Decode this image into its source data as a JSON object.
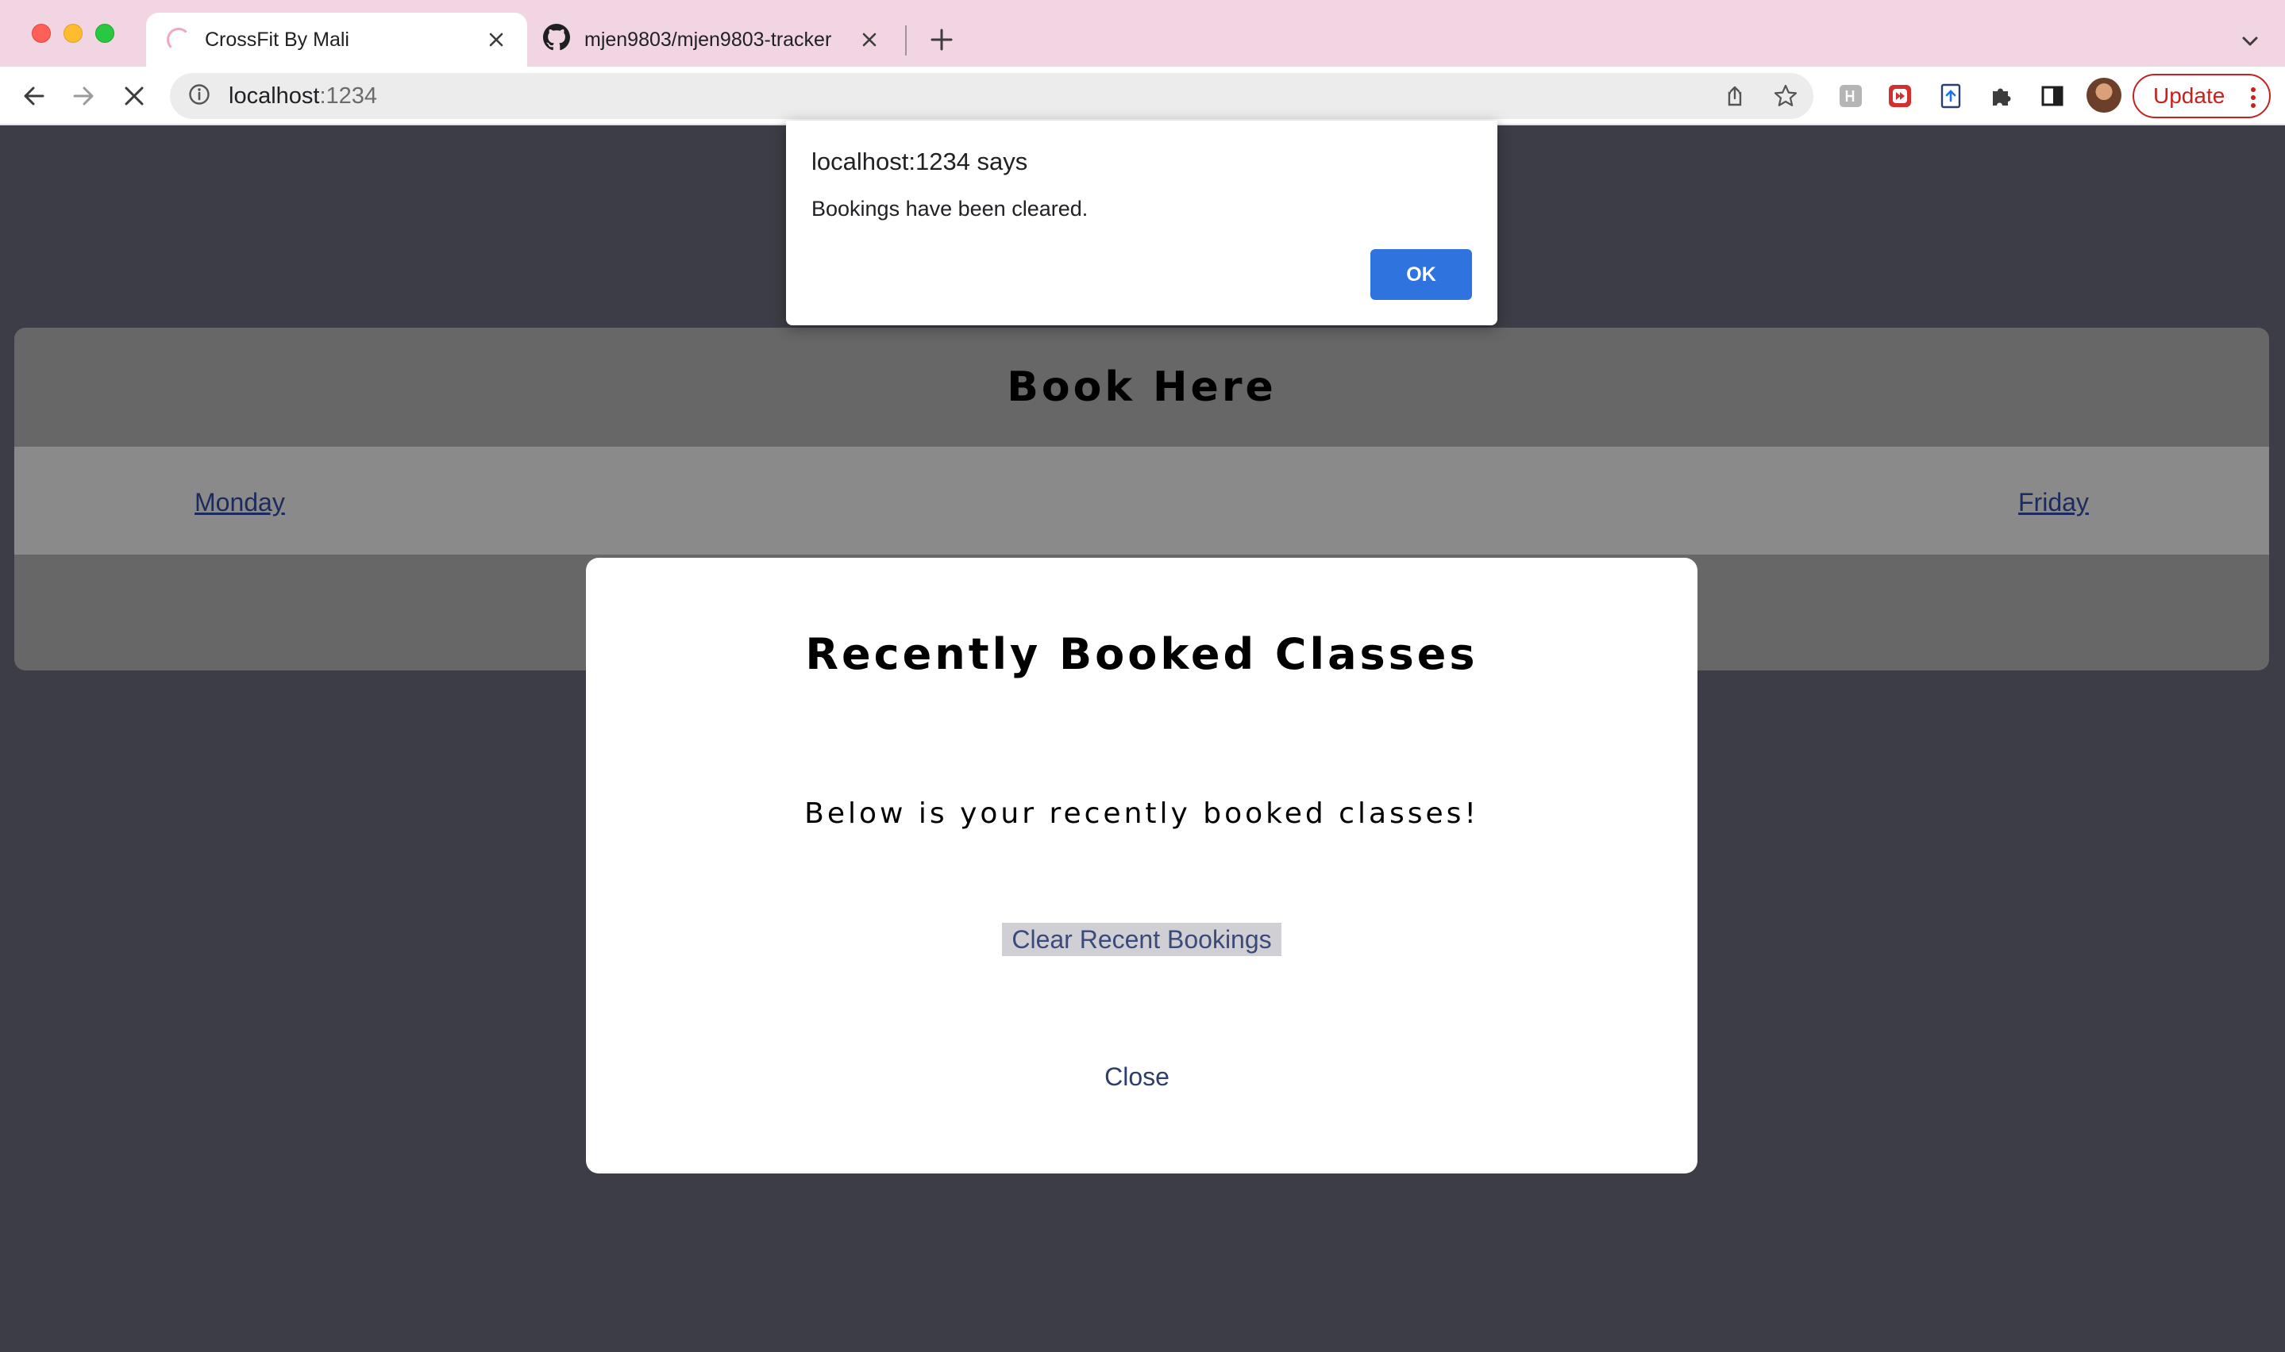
{
  "browser": {
    "tabs": [
      {
        "title": "CrossFit By Mali",
        "active": true,
        "loading": true
      },
      {
        "title": "mjen9803/mjen9803-tracker",
        "active": false,
        "icon": "github-icon"
      }
    ],
    "url_host": "localhost",
    "url_port": ":1234",
    "update_label": "Update"
  },
  "page": {
    "book_title": "Book Here",
    "days": [
      "Monday",
      "Friday"
    ]
  },
  "modal": {
    "title": "Recently Booked Classes",
    "subtitle": "Below is your recently booked classes!",
    "clear_label": "Clear Recent Bookings",
    "close_label": "Close"
  },
  "alert": {
    "title": "localhost:1234 says",
    "message": "Bookings have been cleared.",
    "ok_label": "OK"
  },
  "colors": {
    "tabstrip": "#f2d5e3",
    "page_bg": "#3d3d47",
    "ok_button": "#2f73df",
    "update_red": "#c5221f"
  }
}
